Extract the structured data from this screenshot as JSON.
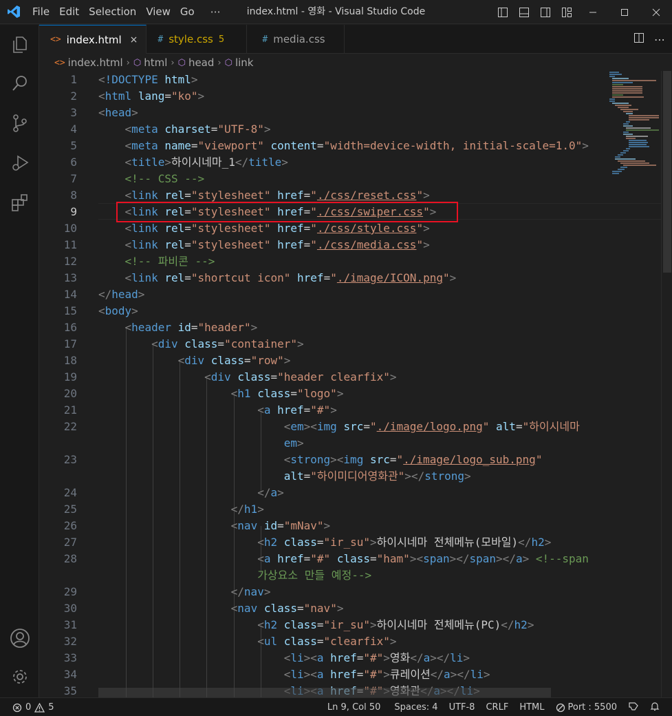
{
  "window": {
    "title": "index.html - 영화 - Visual Studio Code",
    "menu": [
      "File",
      "Edit",
      "Selection",
      "View",
      "Go",
      "⋯"
    ]
  },
  "tabs": [
    {
      "label": "index.html",
      "icon": "<>",
      "active": true,
      "close": "×"
    },
    {
      "label": "style.css",
      "icon": "#",
      "badge": "5"
    },
    {
      "label": "media.css",
      "icon": "#"
    }
  ],
  "breadcrumb": [
    "index.html",
    "html",
    "head",
    "link"
  ],
  "editor": {
    "current_line": 9,
    "lines": [
      {
        "n": "1",
        "html": "<span class=\"t\">&lt;</span><span class=\"tag\">!DOCTYPE</span> <span class=\"at\">html</span><span class=\"t\">&gt;</span>"
      },
      {
        "n": "2",
        "html": "<span class=\"t\">&lt;</span><span class=\"tag\">html</span> <span class=\"at\">lang</span>=<span class=\"str\">\"ko\"</span><span class=\"t\">&gt;</span>"
      },
      {
        "n": "3",
        "html": "<span class=\"t\">&lt;</span><span class=\"tag\">head</span><span class=\"t\">&gt;</span>"
      },
      {
        "n": "4",
        "html": "    <span class=\"t\">&lt;</span><span class=\"tag\">meta</span> <span class=\"at\">charset</span>=<span class=\"str\">\"UTF-8\"</span><span class=\"t\">&gt;</span>"
      },
      {
        "n": "5",
        "html": "    <span class=\"t\">&lt;</span><span class=\"tag\">meta</span> <span class=\"at\">name</span>=<span class=\"str\">\"viewport\"</span> <span class=\"at\">content</span>=<span class=\"str\">\"width=device-width, initial-scale=1.0\"</span><span class=\"t\">&gt;</span>"
      },
      {
        "n": "6",
        "html": "    <span class=\"t\">&lt;</span><span class=\"tag\">title</span><span class=\"t\">&gt;</span><span class=\"txt\">하이시네마_1</span><span class=\"t\">&lt;/</span><span class=\"tag\">title</span><span class=\"t\">&gt;</span>"
      },
      {
        "n": "7",
        "html": "    <span class=\"cm\">&lt;!-- CSS --&gt;</span>"
      },
      {
        "n": "8",
        "html": "    <span class=\"t\">&lt;</span><span class=\"tag\">link</span> <span class=\"at\">rel</span>=<span class=\"str\">\"stylesheet\"</span> <span class=\"at\">href</span>=<span class=\"str\">\"<span class=\"link\">./css/reset.css</span>\"</span><span class=\"t\">&gt;</span>"
      },
      {
        "n": "9",
        "html": "    <span class=\"t\">&lt;</span><span class=\"tag\">link</span> <span class=\"at\">rel</span>=<span class=\"str\">\"stylesheet\"</span> <span class=\"at\">href</span>=<span class=\"str\">\"<span class=\"link\">./css/swiper.css</span>\"</span><span class=\"t\">&gt;</span>"
      },
      {
        "n": "10",
        "html": "    <span class=\"t\">&lt;</span><span class=\"tag\">link</span> <span class=\"at\">rel</span>=<span class=\"str\">\"stylesheet\"</span> <span class=\"at\">href</span>=<span class=\"str\">\"<span class=\"link\">./css/style.css</span>\"</span><span class=\"t\">&gt;</span>"
      },
      {
        "n": "11",
        "html": "    <span class=\"t\">&lt;</span><span class=\"tag\">link</span> <span class=\"at\">rel</span>=<span class=\"str\">\"stylesheet\"</span> <span class=\"at\">href</span>=<span class=\"str\">\"<span class=\"link\">./css/media.css</span>\"</span><span class=\"t\">&gt;</span>"
      },
      {
        "n": "12",
        "html": "    <span class=\"cm\">&lt;!-- 파비콘 --&gt;</span>"
      },
      {
        "n": "13",
        "html": "    <span class=\"t\">&lt;</span><span class=\"tag\">link</span> <span class=\"at\">rel</span>=<span class=\"str\">\"shortcut icon\"</span> <span class=\"at\">href</span>=<span class=\"str\">\"<span class=\"link\">./image/ICON.png</span>\"</span><span class=\"t\">&gt;</span>"
      },
      {
        "n": "14",
        "html": "<span class=\"t\">&lt;/</span><span class=\"tag\">head</span><span class=\"t\">&gt;</span>"
      },
      {
        "n": "15",
        "html": "<span class=\"t\">&lt;</span><span class=\"tag\">body</span><span class=\"t\">&gt;</span>"
      },
      {
        "n": "16",
        "html": "    <span class=\"t\">&lt;</span><span class=\"tag\">header</span> <span class=\"at\">id</span>=<span class=\"str\">\"header\"</span><span class=\"t\">&gt;</span>"
      },
      {
        "n": "17",
        "html": "        <span class=\"t\">&lt;</span><span class=\"tag\">div</span> <span class=\"at\">class</span>=<span class=\"str\">\"container\"</span><span class=\"t\">&gt;</span>"
      },
      {
        "n": "18",
        "html": "            <span class=\"t\">&lt;</span><span class=\"tag\">div</span> <span class=\"at\">class</span>=<span class=\"str\">\"row\"</span><span class=\"t\">&gt;</span>"
      },
      {
        "n": "19",
        "html": "                <span class=\"t\">&lt;</span><span class=\"tag\">div</span> <span class=\"at\">class</span>=<span class=\"str\">\"header clearfix\"</span><span class=\"t\">&gt;</span>"
      },
      {
        "n": "20",
        "html": "                    <span class=\"t\">&lt;</span><span class=\"tag\">h1</span> <span class=\"at\">class</span>=<span class=\"str\">\"logo\"</span><span class=\"t\">&gt;</span>"
      },
      {
        "n": "21",
        "html": "                        <span class=\"t\">&lt;</span><span class=\"tag\">a</span> <span class=\"at\">href</span>=<span class=\"str\">\"#\"</span><span class=\"t\">&gt;</span>"
      },
      {
        "n": "22",
        "html": "                            <span class=\"t\">&lt;</span><span class=\"tag\">em</span><span class=\"t\">&gt;&lt;</span><span class=\"tag\">img</span> <span class=\"at\">src</span>=<span class=\"str\">\"<span class=\"link\">./image/logo.png</span>\"</span> <span class=\"at\">alt</span>=<span class=\"str\">\"하이시네마</span>"
      },
      {
        "n": "",
        "html": "                            <span class=\"tag\">em</span><span class=\"t\">&gt;</span>"
      },
      {
        "n": "23",
        "html": "                            <span class=\"t\">&lt;</span><span class=\"tag\">strong</span><span class=\"t\">&gt;&lt;</span><span class=\"tag\">img</span> <span class=\"at\">src</span>=<span class=\"str\">\"<span class=\"link\">./image/logo_sub.png</span>\"</span>"
      },
      {
        "n": "",
        "html": "                            <span class=\"at\">alt</span>=<span class=\"str\">\"하이미디어영화관\"</span><span class=\"t\">&gt;&lt;/</span><span class=\"tag\">strong</span><span class=\"t\">&gt;</span>"
      },
      {
        "n": "24",
        "html": "                        <span class=\"t\">&lt;/</span><span class=\"tag\">a</span><span class=\"t\">&gt;</span>"
      },
      {
        "n": "25",
        "html": "                    <span class=\"t\">&lt;/</span><span class=\"tag\">h1</span><span class=\"t\">&gt;</span>"
      },
      {
        "n": "26",
        "html": "                    <span class=\"t\">&lt;</span><span class=\"tag\">nav</span> <span class=\"at\">id</span>=<span class=\"str\">\"mNav\"</span><span class=\"t\">&gt;</span>"
      },
      {
        "n": "27",
        "html": "                        <span class=\"t\">&lt;</span><span class=\"tag\">h2</span> <span class=\"at\">class</span>=<span class=\"str\">\"ir_su\"</span><span class=\"t\">&gt;</span><span class=\"txt\">하이시네마 전체메뉴(모바일)</span><span class=\"t\">&lt;/</span><span class=\"tag\">h2</span><span class=\"t\">&gt;</span>"
      },
      {
        "n": "28",
        "html": "                        <span class=\"t\">&lt;</span><span class=\"tag\">a</span> <span class=\"at\">href</span>=<span class=\"str\">\"#\"</span> <span class=\"at\">class</span>=<span class=\"str\">\"ham\"</span><span class=\"t\">&gt;&lt;</span><span class=\"tag\">span</span><span class=\"t\">&gt;&lt;/</span><span class=\"tag\">span</span><span class=\"t\">&gt;&lt;/</span><span class=\"tag\">a</span><span class=\"t\">&gt;</span> <span class=\"cm\">&lt;!--span</span>"
      },
      {
        "n": "",
        "html": "                        <span class=\"cm\">가상요소 만들 예정--&gt;</span>"
      },
      {
        "n": "29",
        "html": "                    <span class=\"t\">&lt;/</span><span class=\"tag\">nav</span><span class=\"t\">&gt;</span>"
      },
      {
        "n": "30",
        "html": "                    <span class=\"t\">&lt;</span><span class=\"tag\">nav</span> <span class=\"at\">class</span>=<span class=\"str\">\"nav\"</span><span class=\"t\">&gt;</span>"
      },
      {
        "n": "31",
        "html": "                        <span class=\"t\">&lt;</span><span class=\"tag\">h2</span> <span class=\"at\">class</span>=<span class=\"str\">\"ir_su\"</span><span class=\"t\">&gt;</span><span class=\"txt\">하이시네마 전체메뉴(PC)</span><span class=\"t\">&lt;/</span><span class=\"tag\">h2</span><span class=\"t\">&gt;</span>"
      },
      {
        "n": "32",
        "html": "                        <span class=\"t\">&lt;</span><span class=\"tag\">ul</span> <span class=\"at\">class</span>=<span class=\"str\">\"clearfix\"</span><span class=\"t\">&gt;</span>"
      },
      {
        "n": "33",
        "html": "                            <span class=\"t\">&lt;</span><span class=\"tag\">li</span><span class=\"t\">&gt;&lt;</span><span class=\"tag\">a</span> <span class=\"at\">href</span>=<span class=\"str\">\"#\"</span><span class=\"t\">&gt;</span><span class=\"txt\">영화</span><span class=\"t\">&lt;/</span><span class=\"tag\">a</span><span class=\"t\">&gt;&lt;/</span><span class=\"tag\">li</span><span class=\"t\">&gt;</span>"
      },
      {
        "n": "34",
        "html": "                            <span class=\"t\">&lt;</span><span class=\"tag\">li</span><span class=\"t\">&gt;&lt;</span><span class=\"tag\">a</span> <span class=\"at\">href</span>=<span class=\"str\">\"#\"</span><span class=\"t\">&gt;</span><span class=\"txt\">큐레이션</span><span class=\"t\">&lt;/</span><span class=\"tag\">a</span><span class=\"t\">&gt;&lt;/</span><span class=\"tag\">li</span><span class=\"t\">&gt;</span>"
      },
      {
        "n": "35",
        "html": "                            <span class=\"t\">&lt;</span><span class=\"tag\">li</span><span class=\"t\">&gt;&lt;</span><span class=\"tag\">a</span> <span class=\"at\">href</span>=<span class=\"str\">\"#\"</span><span class=\"t\">&gt;</span><span class=\"txt\">영화관</span><span class=\"t\">&lt;/</span><span class=\"tag\">a</span><span class=\"t\">&gt;&lt;/</span><span class=\"tag\">li</span><span class=\"t\">&gt;</span>"
      }
    ]
  },
  "status": {
    "errors": "0",
    "warnings": "5",
    "position": "Ln 9, Col 50",
    "spaces": "Spaces: 4",
    "encoding": "UTF-8",
    "eol": "CRLF",
    "language": "HTML",
    "port": "Port : 5500"
  },
  "colors": {
    "accent": "#0078d4",
    "highlight_box": "#e81123",
    "tag": "#569cd6",
    "attribute": "#9cdcfe",
    "string": "#ce9178",
    "comment": "#6a9955"
  }
}
